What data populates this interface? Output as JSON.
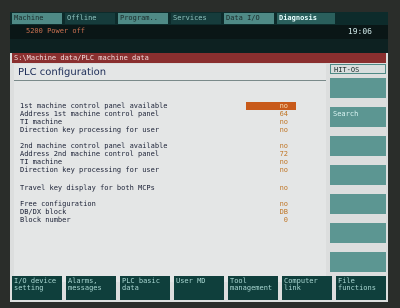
{
  "top_menu": [
    "Machine",
    "Offline",
    "Program..",
    "Services",
    "Data I/O",
    "Diagnosis"
  ],
  "alarm": "5200 Power off",
  "time": "19:06",
  "path": "S:\\Machine data/PLC machine data",
  "title": "PLC configuration",
  "groups": [
    [
      {
        "label": "1st machine control panel available",
        "value": "no"
      },
      {
        "label": "Address 1st machine control panel",
        "value": "64"
      },
      {
        "label": "TI machine",
        "value": "no"
      },
      {
        "label": "Direction key processing for user",
        "value": "no"
      }
    ],
    [
      {
        "label": "2nd machine control panel available",
        "value": "no"
      },
      {
        "label": "Address 2nd machine control panel",
        "value": "72"
      },
      {
        "label": "TI machine",
        "value": "no"
      },
      {
        "label": "Direction key processing for user",
        "value": "no"
      }
    ],
    [
      {
        "label": "Travel key display for both MCPs",
        "value": "no"
      }
    ],
    [
      {
        "label": "Free configuration",
        "value": "no"
      },
      {
        "label": "DB/DX block",
        "value": "DB"
      },
      {
        "label": "Block number",
        "value": "0"
      }
    ]
  ],
  "right_title": "HIT-OS",
  "right_keys": [
    "",
    "Search",
    "",
    "",
    "",
    "",
    ""
  ],
  "bottom_keys": [
    "I/O device setting",
    "Alarms, messages",
    "PLC basic data",
    "User MD",
    "Tool management",
    "Computer link",
    "File functions"
  ],
  "colors": {
    "accent": "#c85a1a",
    "panel": "#e4e6e6",
    "softkey": "#5c9692",
    "path_bar": "#8a2f2f"
  }
}
